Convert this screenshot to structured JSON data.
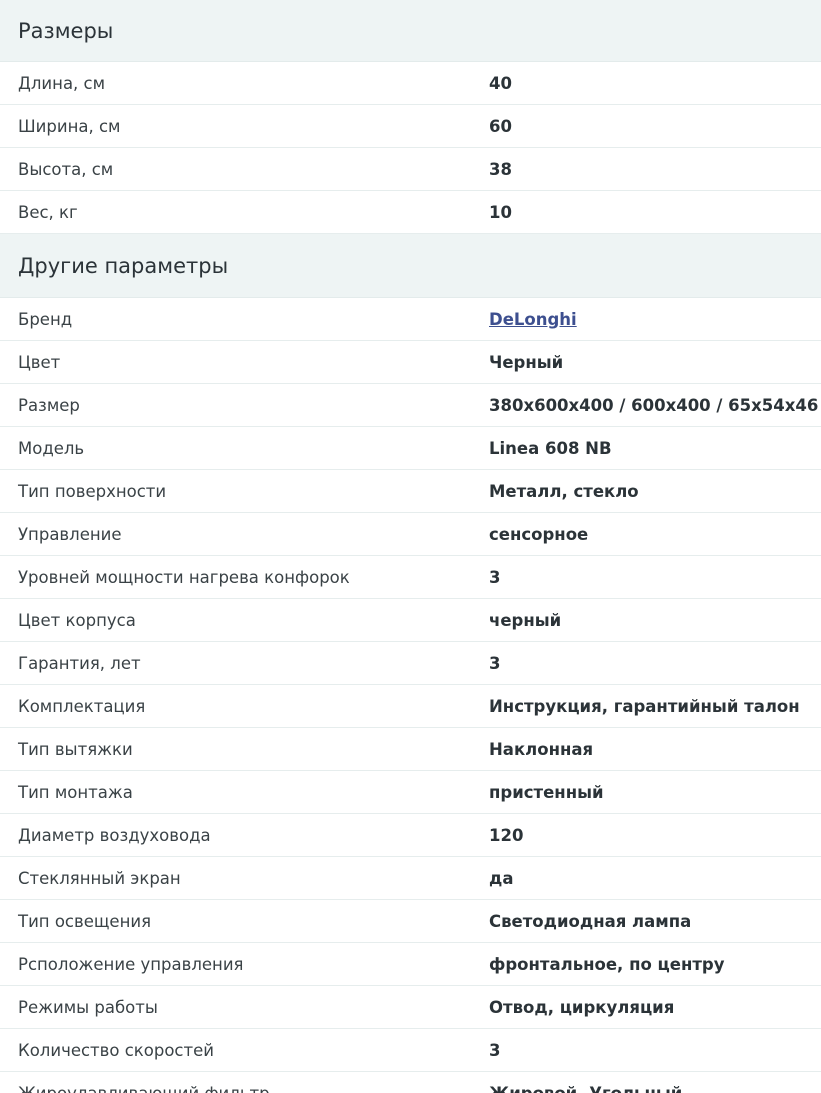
{
  "sections": [
    {
      "title": "Размеры",
      "rows": [
        {
          "label": "Длина, см",
          "value": "40"
        },
        {
          "label": "Ширина, см",
          "value": "60"
        },
        {
          "label": "Высота, см",
          "value": "38"
        },
        {
          "label": "Вес, кг",
          "value": "10"
        }
      ]
    },
    {
      "title": "Другие параметры",
      "rows": [
        {
          "label": "Бренд",
          "value": "DeLonghi"
        },
        {
          "label": "Цвет",
          "value": "Черный"
        },
        {
          "label": "Размер",
          "value": "380x600x400 / 600x400 / 65x54x46"
        },
        {
          "label": "Модель",
          "value": "Linea 608 NB"
        },
        {
          "label": "Тип поверхности",
          "value": "Металл, стекло"
        },
        {
          "label": "Управление",
          "value": "сенсорное"
        },
        {
          "label": "Уровней мощности нагрева конфорок",
          "value": "3"
        },
        {
          "label": "Цвет корпуса",
          "value": "черный"
        },
        {
          "label": "Гарантия, лет",
          "value": "3"
        },
        {
          "label": "Комплектация",
          "value": "Инструкция, гарантийный талон"
        },
        {
          "label": "Тип вытяжки",
          "value": "Наклонная"
        },
        {
          "label": "Тип монтажа",
          "value": "пристенный"
        },
        {
          "label": "Диаметр воздуховода",
          "value": "120"
        },
        {
          "label": "Стеклянный экран",
          "value": "да"
        },
        {
          "label": "Тип освещения",
          "value": "Светодиодная лампа"
        },
        {
          "label": "Рсположение управления",
          "value": "фронтальное, по центру"
        },
        {
          "label": "Режимы работы",
          "value": "Отвод, циркуляция"
        },
        {
          "label": "Количество скоростей",
          "value": "3"
        },
        {
          "label": "Жироулавливающий фильтр",
          "value": "Жировой, Угольный"
        }
      ]
    }
  ]
}
